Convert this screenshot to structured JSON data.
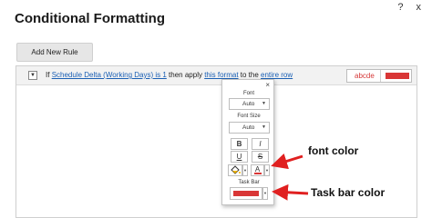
{
  "window": {
    "help_icon": "?",
    "close_icon": "x"
  },
  "dialog": {
    "title": "Conditional Formatting",
    "add_rule_label": "Add New Rule"
  },
  "rule": {
    "prefix": "If",
    "condition_link": "Schedule Delta (Working Days) is 1",
    "middle": "then apply",
    "format_link": "this format",
    "to_text": "to the",
    "scope_link": "entire row",
    "preview_text": "abcde",
    "preview_bar_color": "#d93636"
  },
  "format_popup": {
    "close": "×",
    "font_label": "Font",
    "font_value": "Auto",
    "font_size_label": "Font Size",
    "font_size_value": "Auto",
    "bold": "B",
    "italic": "I",
    "underline": "U",
    "strikethrough": "S",
    "font_color_glyph": "A",
    "font_color": "#d93636",
    "task_bar_label": "Task Bar",
    "task_bar_color": "#d93636"
  },
  "annotations": {
    "font_color": "font color",
    "task_bar_color": "Task bar color",
    "arrow_color": "#e02020"
  }
}
